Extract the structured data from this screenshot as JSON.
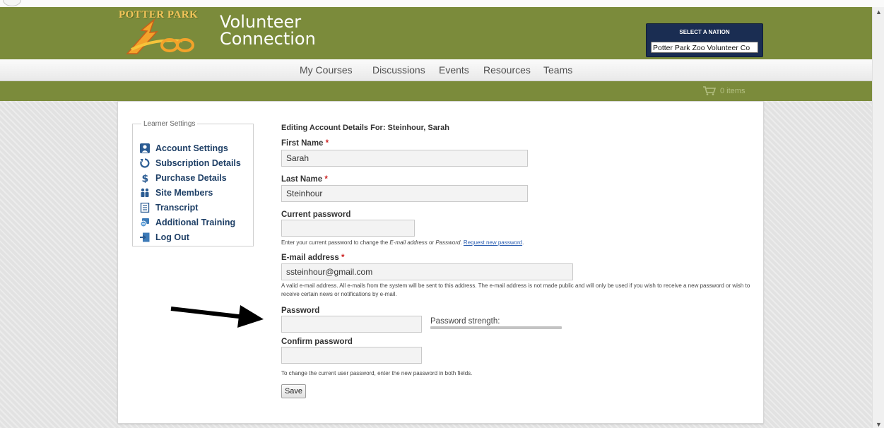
{
  "header": {
    "logo_text": "POTTER PARK",
    "logo_script": "Zoo",
    "brand_line1": "Volunteer",
    "brand_line2": "Connection",
    "nation_title": "SELECT A NATION",
    "nation_value": "Potter Park Zoo Volunteer Co"
  },
  "nav": {
    "items": [
      "My Courses",
      "Discussions",
      "Events",
      "Resources",
      "Teams"
    ]
  },
  "cart": {
    "label": "0 items"
  },
  "sidebar": {
    "legend": "Learner Settings",
    "items": [
      {
        "label": "Account Settings",
        "icon": "account-icon"
      },
      {
        "label": "Subscription Details",
        "icon": "refresh-icon"
      },
      {
        "label": "Purchase Details",
        "icon": "dollar-icon"
      },
      {
        "label": "Site Members",
        "icon": "members-icon"
      },
      {
        "label": "Transcript",
        "icon": "document-icon"
      },
      {
        "label": "Additional Training",
        "icon": "training-icon"
      },
      {
        "label": "Log Out",
        "icon": "logout-icon"
      }
    ]
  },
  "form": {
    "heading": "Editing Account Details For: Steinhour, Sarah",
    "first_name_label": "First Name",
    "first_name_value": "Sarah",
    "last_name_label": "Last Name",
    "last_name_value": "Steinhour",
    "required_mark": "*",
    "current_password_label": "Current password",
    "current_password_help_1": "Enter your current password to change the ",
    "current_password_help_email": "E-mail address",
    "current_password_help_or": " or ",
    "current_password_help_pw": "Password",
    "current_password_help_2": ". ",
    "request_link": "Request new password",
    "current_password_help_3": ".",
    "email_label": "E-mail address",
    "email_value": "ssteinhour@gmail.com",
    "email_help": "A valid e-mail address. All e-mails from the system will be sent to this address. The e-mail address is not made public and will only be used if you wish to receive a new password or wish to receive certain news or notifications by e-mail.",
    "password_label": "Password",
    "password_strength_label": "Password strength:",
    "confirm_password_label": "Confirm password",
    "password_help": "To change the current user password, enter the new password in both fields.",
    "save_label": "Save"
  },
  "colors": {
    "header_green": "#7b8b3b",
    "nation_navy": "#1a2d52",
    "link_blue": "#2a5db0",
    "sidebar_text": "#1e3f66",
    "required_red": "#cc2222"
  }
}
